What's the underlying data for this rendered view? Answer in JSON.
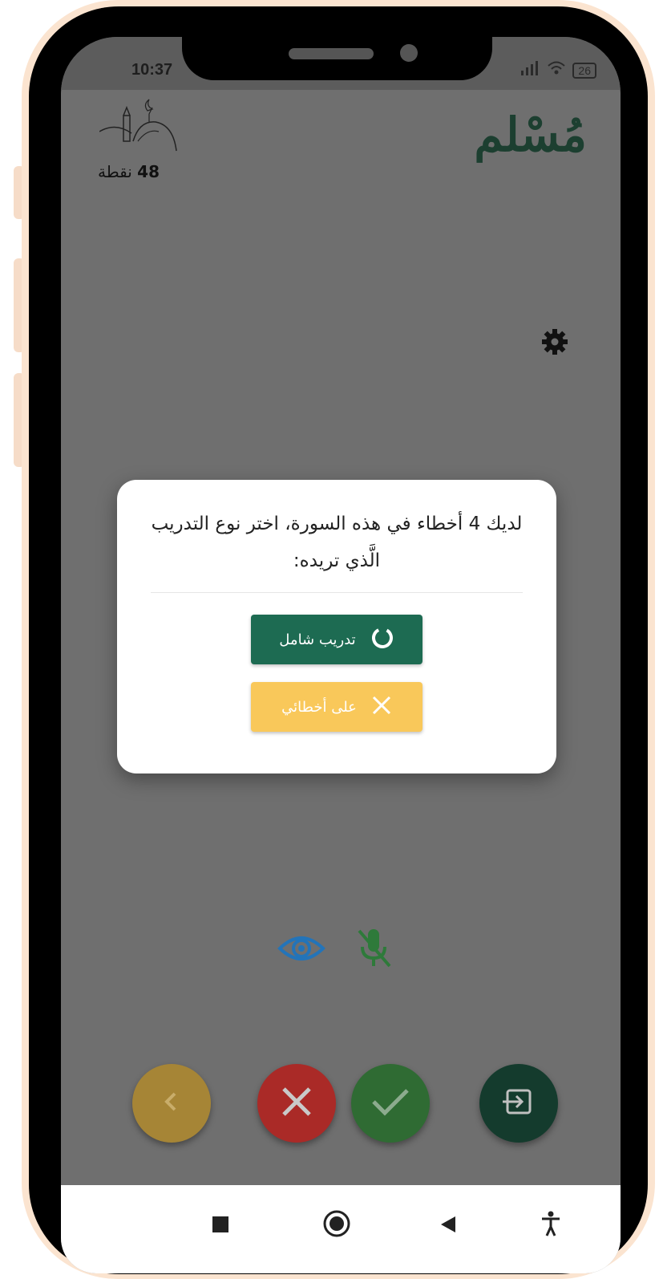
{
  "status_bar": {
    "time": "10:37",
    "battery": "26"
  },
  "header": {
    "brand": "مُسْلم",
    "points_value": "48",
    "points_label": "نقطة"
  },
  "dialog": {
    "message": "لديك 4 أخطاء في هذه السورة، اختر نوع التدريب الَّذي تريده:",
    "full_training_label": "تدريب شامل",
    "my_mistakes_label": "على أخطائي"
  },
  "colors": {
    "primary_green": "#1d6b52",
    "accent_yellow": "#f9c85a",
    "wrong_red": "#aa2a27",
    "right_green": "#2f6b33",
    "dark_green": "#143b2d",
    "reveal_blue": "#2374b9"
  },
  "icons": {
    "settings": "gear-icon",
    "reveal": "eye-icon",
    "mic": "mic-off-icon",
    "back": "chevron-left-icon",
    "wrong": "close-icon",
    "right": "check-icon",
    "exit": "exit-icon",
    "full_training": "loading-circle-icon",
    "my_mistakes": "close-icon"
  },
  "nav_bar": [
    "square-icon",
    "home-circle-icon",
    "back-triangle-icon",
    "accessibility-icon"
  ]
}
